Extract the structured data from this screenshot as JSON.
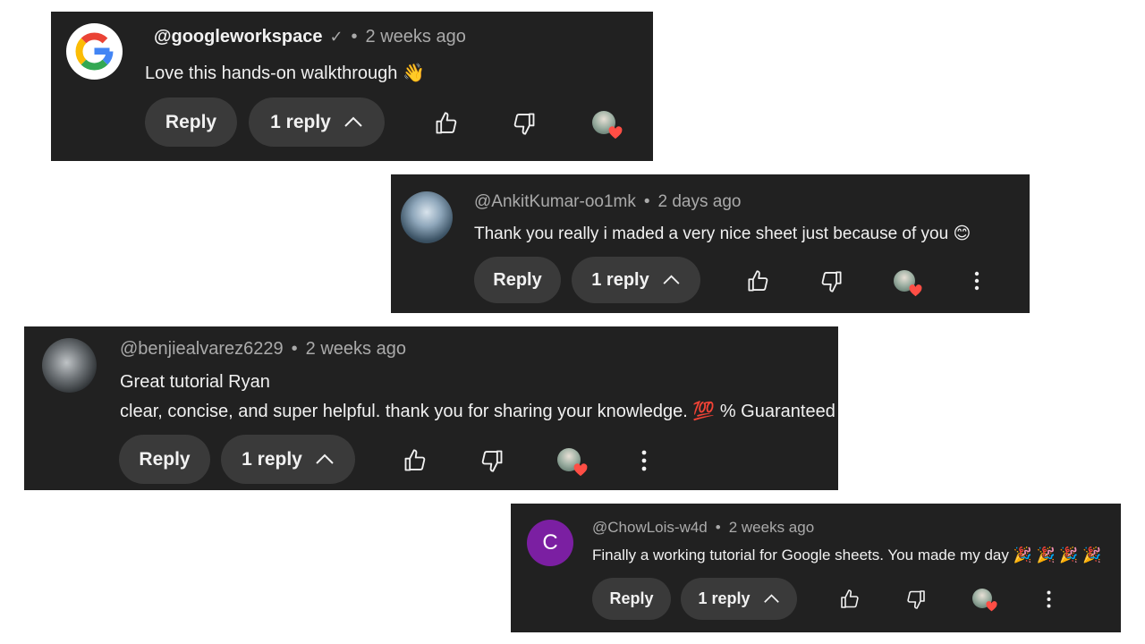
{
  "comments": [
    {
      "handle": "@googleworkspace",
      "verified": "✓",
      "time": "2 weeks ago",
      "lines": [
        "Love this hands-on walkthrough 👋"
      ],
      "reply_label": "Reply",
      "replies_label": "1 reply",
      "avatar_icon": "google-logo"
    },
    {
      "handle": "@AnkitKumar-oo1mk",
      "time": "2 days ago",
      "lines": [
        "Thank you really i maded a very nice sheet just because of you 😊"
      ],
      "reply_label": "Reply",
      "replies_label": "1 reply",
      "avatar_icon": "profile-photo"
    },
    {
      "handle": "@benjiealvarez6229",
      "time": "2 weeks ago",
      "lines": [
        "Great tutorial Ryan",
        "clear, concise, and super helpful. thank you for sharing your knowledge. 💯 % Guaranteed"
      ],
      "reply_label": "Reply",
      "replies_label": "1 reply",
      "avatar_icon": "profile-photo"
    },
    {
      "handle": "@ChowLois-w4d",
      "time": "2 weeks ago",
      "lines": [
        "Finally a working tutorial for Google sheets. You made my day 🎉 🎉 🎉 🎉"
      ],
      "reply_label": "Reply",
      "replies_label": "1 reply",
      "avatar_letter": "C",
      "avatar_color": "#7b1fa2"
    }
  ],
  "separator": "•",
  "icons": {
    "like": "thumbs-up-icon",
    "dislike": "thumbs-down-icon",
    "creator_heart": "creator-heart-icon",
    "more": "more-vert-icon",
    "chevron": "chevron-up-icon"
  },
  "colors": {
    "card_bg": "#212121",
    "pill_bg": "#3a3a3a",
    "text": "#f1f1f1",
    "muted": "#aaaaaa",
    "heart": "#ff4e45"
  }
}
